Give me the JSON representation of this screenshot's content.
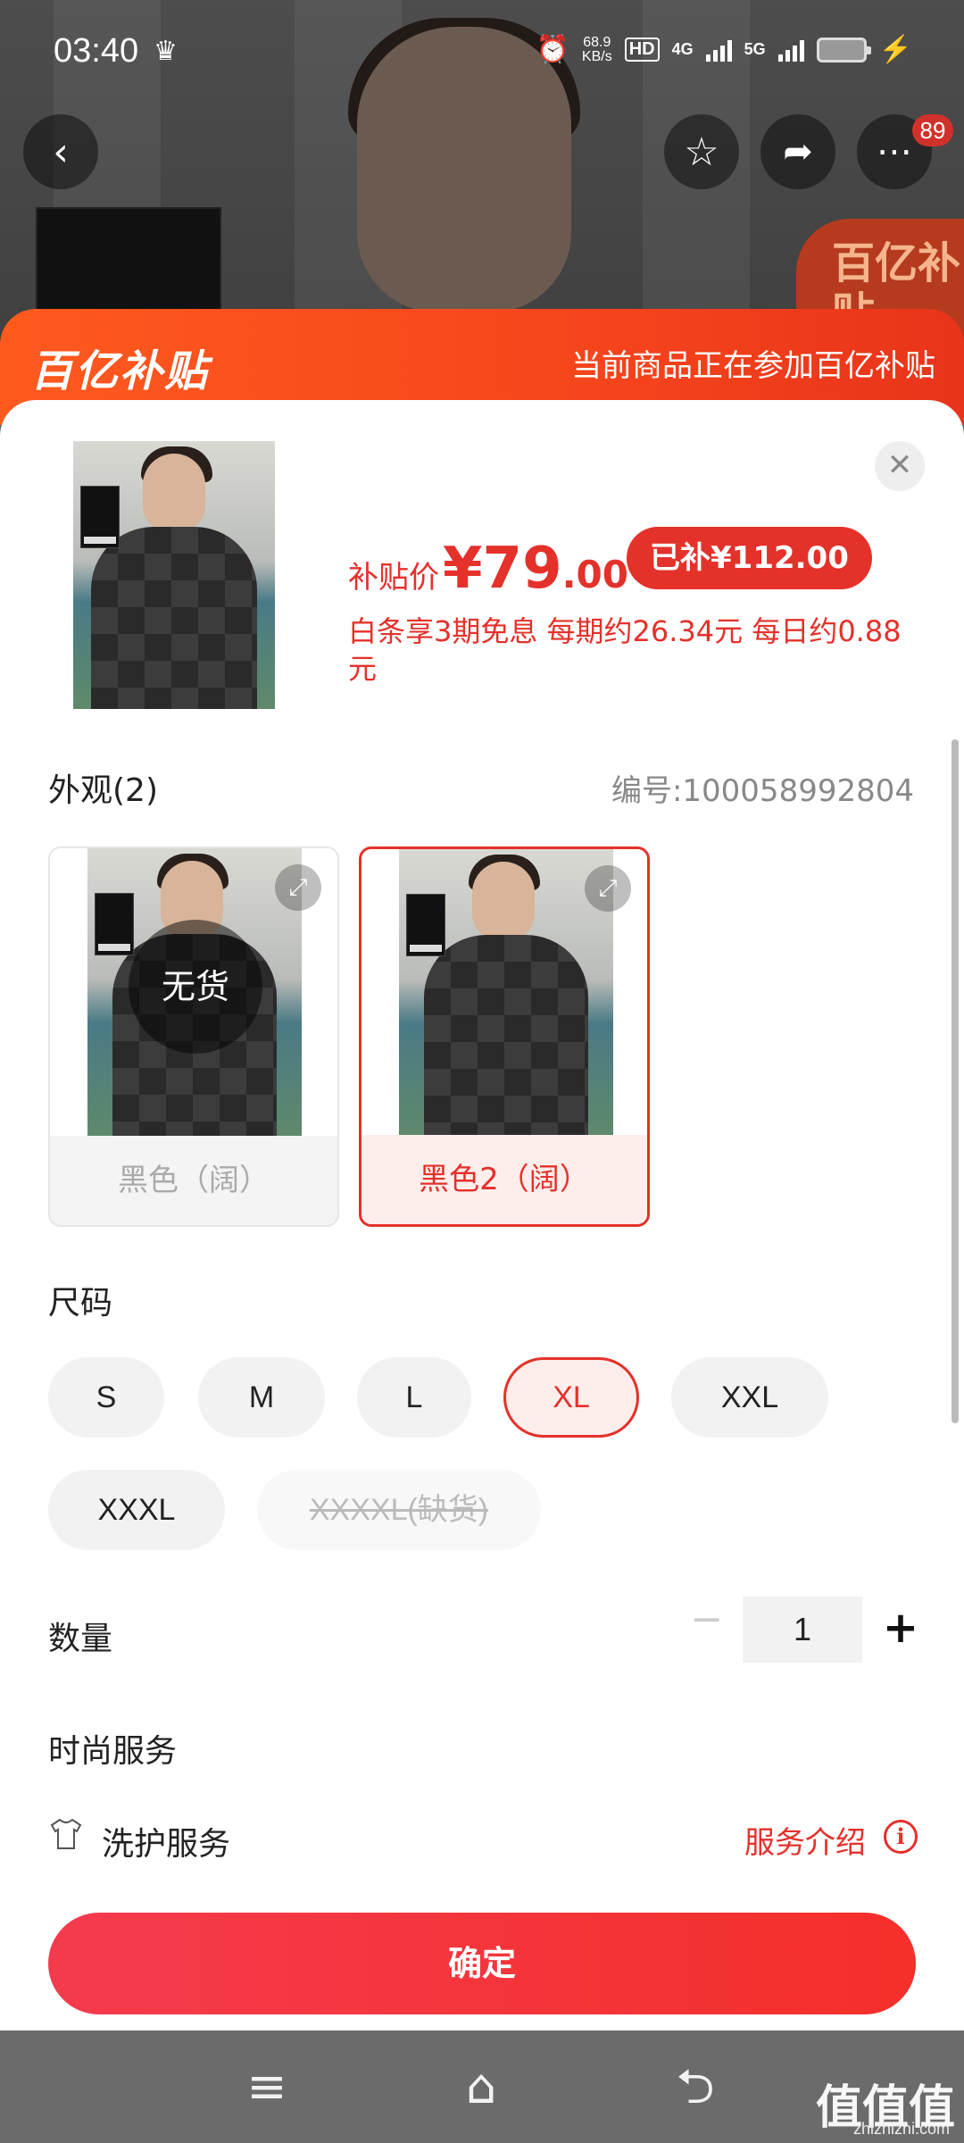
{
  "status_bar": {
    "time": "03:40",
    "net_speed_value": "68.9",
    "net_speed_unit": "KB/s",
    "hd_label": "HD",
    "net_4g": "4G",
    "net_5g": "5G"
  },
  "top_nav": {
    "notification_count": "89"
  },
  "background_badge": "百亿补贴",
  "banner": {
    "logo": "百亿补贴",
    "text": "当前商品正在参加百亿补贴"
  },
  "price": {
    "label": "补贴价",
    "main": "¥79",
    "decimals": ".00",
    "subsidy_pill": "已补¥112.00",
    "installment": "白条享3期免息 每期约26.34元 每日约0.88元"
  },
  "appearance": {
    "title": "外观(2)",
    "sku_code": "编号:100058992804",
    "variants": [
      {
        "label": "黑色（阔）",
        "badge": "无货",
        "state": "disabled"
      },
      {
        "label": "黑色2（阔）",
        "state": "selected"
      }
    ]
  },
  "size": {
    "title": "尺码",
    "options": [
      "S",
      "M",
      "L",
      "XL",
      "XXL",
      "XXXL",
      "XXXXL(缺货)"
    ],
    "selected": "XL"
  },
  "quantity": {
    "title": "数量",
    "value": "1",
    "minus": "−",
    "plus": "+"
  },
  "service": {
    "title": "时尚服务",
    "item_name": "洗护服务",
    "intro_link": "服务介绍"
  },
  "confirm_button": "确定",
  "watermark": {
    "text": "值值值",
    "site": "zhizhizhi.com"
  },
  "colors": {
    "accent": "#e4312a",
    "banner_orange": "#f6451c"
  },
  "icons": [
    "back-icon",
    "favorite-star-icon",
    "share-icon",
    "more-icon",
    "close-icon",
    "expand-icon",
    "tshirt-icon",
    "info-icon",
    "menu-icon",
    "home-icon",
    "return-icon"
  ]
}
